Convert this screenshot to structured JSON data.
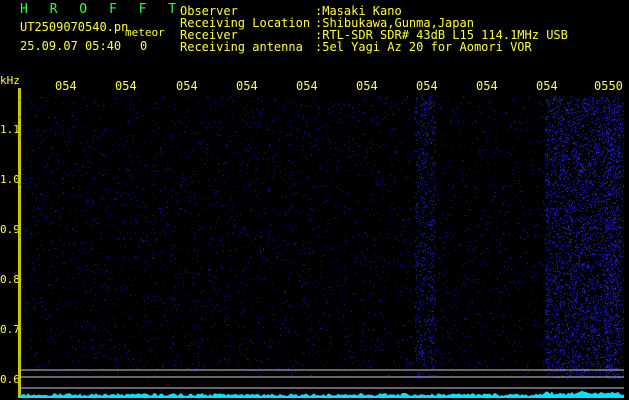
{
  "header": {
    "app_title": "H R O F F T",
    "file_name": "UT2509070540.pn",
    "mode": "meteor",
    "date_time": "25.09.07 05:40",
    "count": "0"
  },
  "info": [
    {
      "key": "Observer",
      "value": ":Masaki Kano"
    },
    {
      "key": "Receiving Location",
      "value": ":Shibukawa,Gunma,Japan"
    },
    {
      "key": "Receiver",
      "value": ":RTL-SDR SDR# 43dB L15 114.1MHz USB"
    },
    {
      "key": "Receiving antenna",
      "value": ":5el Yagi Az 20 for Aomori VOR"
    }
  ],
  "axis": {
    "y_unit": "kHz",
    "y_ticks": [
      "1.1",
      "1.0",
      "0.9",
      "0.8",
      "0.7",
      "0.6"
    ],
    "x_ticks": [
      "054",
      "054",
      "054",
      "054",
      "054",
      "054",
      "054",
      "054",
      "054",
      "0550"
    ]
  },
  "colors": {
    "text": "#ffff33",
    "title": "#33ff33",
    "noise": "#1a1aa0",
    "trace": "#00e5ff",
    "guide": "#c8c8c8"
  }
}
